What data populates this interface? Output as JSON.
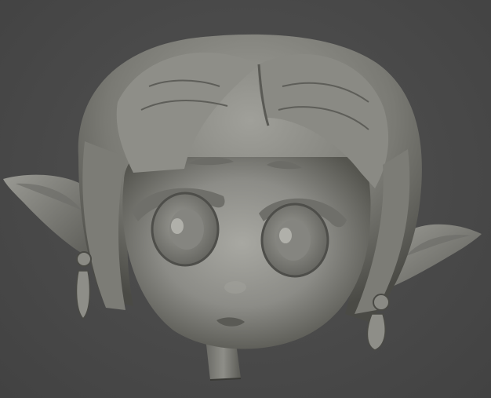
{
  "viewport": {
    "background_color": "#4a4a4a",
    "model_color": "#8a8a86",
    "model_shadow_color": "#3a3a38",
    "model_highlight_color": "#b4b4ae"
  },
  "scene": {
    "subject": "sculpt-head",
    "parts": [
      "hair",
      "face",
      "left-ear",
      "right-ear",
      "left-eye",
      "right-eye",
      "left-earring",
      "right-earring",
      "neck"
    ]
  }
}
